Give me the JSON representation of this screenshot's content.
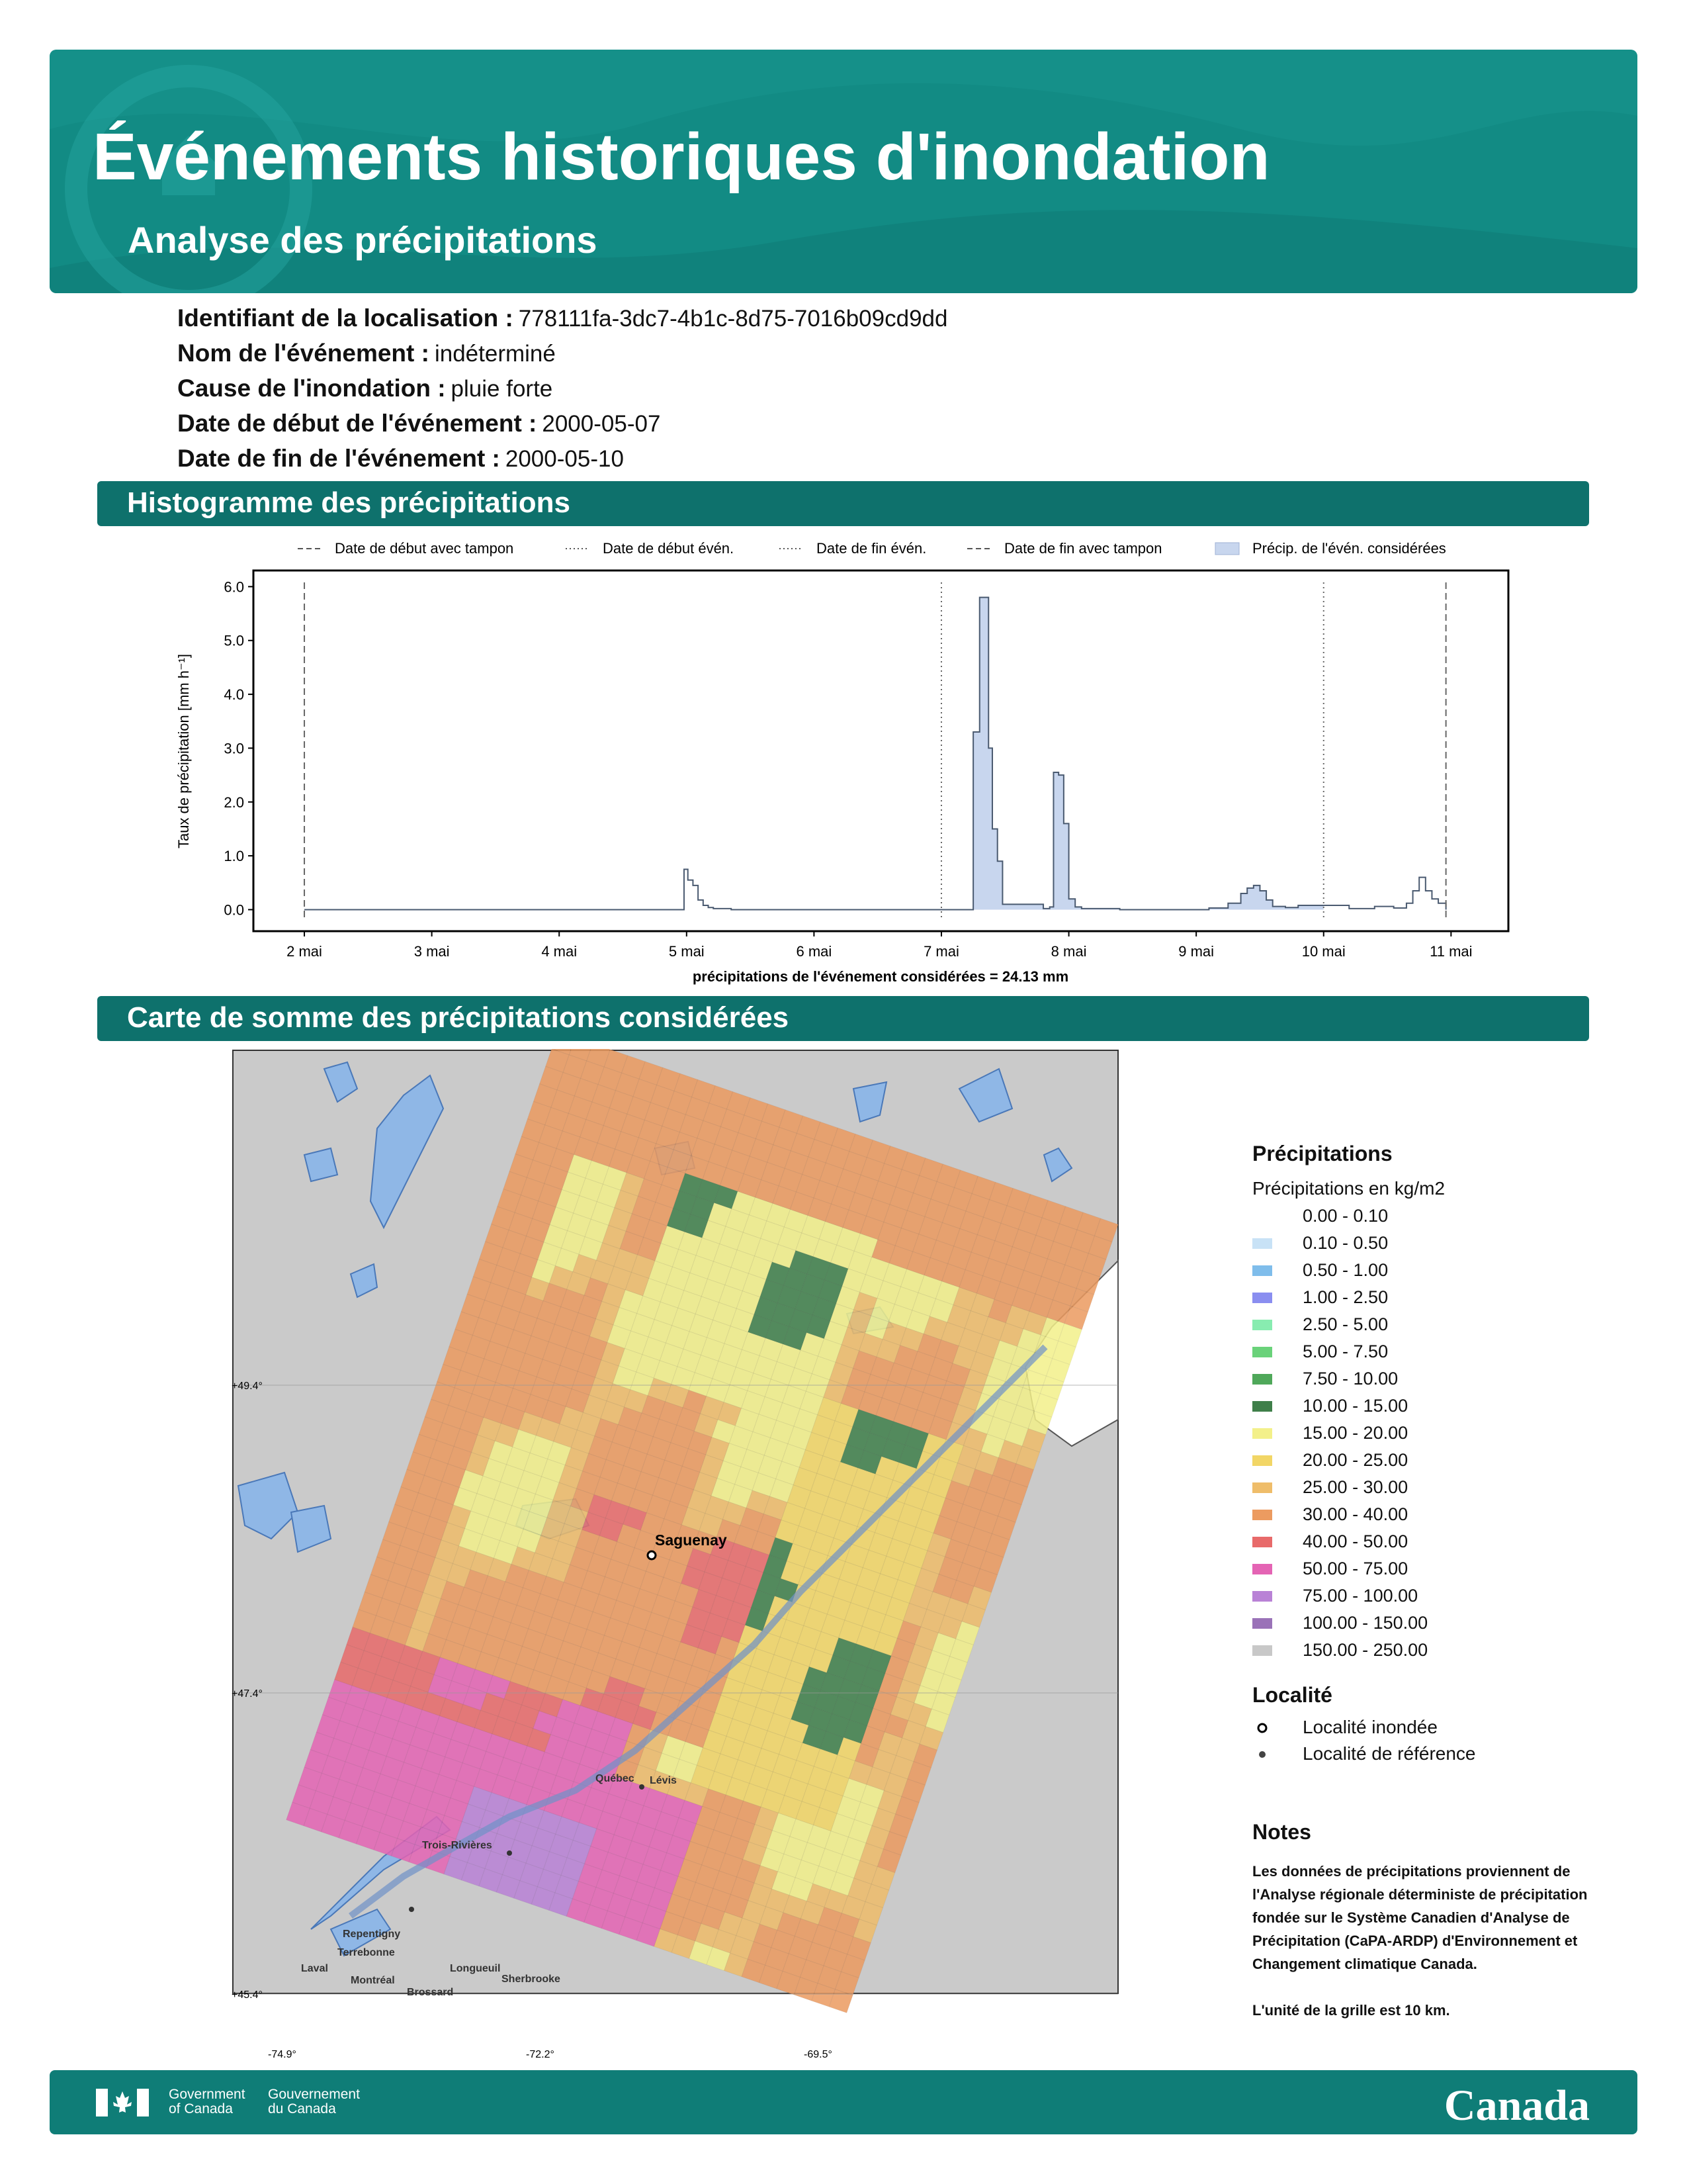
{
  "header": {
    "title": "Événements historiques d'inondation",
    "subtitle": "Analyse des précipitations"
  },
  "event": {
    "fields": [
      {
        "label": "Identifiant de la localisation :",
        "value": "778111fa-3dc7-4b1c-8d75-7016b09cd9dd"
      },
      {
        "label": "Nom de l'événement :",
        "value": "indéterminé"
      },
      {
        "label": "Cause de l'inondation :",
        "value": "pluie forte"
      },
      {
        "label": "Date de début de l'événement :",
        "value": "2000-05-07"
      },
      {
        "label": "Date de fin de l'événement :",
        "value": "2000-05-10"
      }
    ]
  },
  "sections": {
    "histogram": "Histogramme des précipitations",
    "map": "Carte de somme des précipitations considérées"
  },
  "chart_data": {
    "type": "area",
    "ylabel": "Taux de précipitation [mm h⁻¹]",
    "xlabel": "précipitations de l'événement considérées = 24.13 mm",
    "x_range_days": [
      1.6,
      11.45
    ],
    "ylim": [
      -0.4,
      6.3
    ],
    "y_ticks": [
      "0.0",
      "1.0",
      "2.0",
      "3.0",
      "4.0",
      "5.0",
      "6.0"
    ],
    "x_ticks": [
      "2 mai",
      "3 mai",
      "4 mai",
      "5 mai",
      "6 mai",
      "7 mai",
      "8 mai",
      "9 mai",
      "10 mai",
      "11 mai"
    ],
    "legend": [
      {
        "label": "Date de début avec tampon",
        "style": "dashed",
        "color": "#555555"
      },
      {
        "label": "Date de début évén.",
        "style": "dotted",
        "color": "#555555"
      },
      {
        "label": "Date de fin évén.",
        "style": "dotted",
        "color": "#555555"
      },
      {
        "label": "Date de fin avec tampon",
        "style": "dashed",
        "color": "#555555"
      },
      {
        "label": "Précip. de l'évén. considérées",
        "style": "fill",
        "color": "#c8d6ee"
      }
    ],
    "vlines": [
      {
        "x": 2.0,
        "style": "dashed"
      },
      {
        "x": 7.0,
        "style": "dotted"
      },
      {
        "x": 10.0,
        "style": "dotted"
      },
      {
        "x": 10.96,
        "style": "dashed"
      }
    ],
    "event_span": [
      7.0,
      10.0
    ],
    "series": [
      {
        "x": [
          2.0,
          4.95,
          4.98,
          5.01,
          5.05,
          5.09,
          5.13,
          5.17,
          5.21,
          5.25,
          5.35,
          7.0,
          7.2,
          7.25,
          7.3,
          7.33,
          7.37,
          7.4,
          7.44,
          7.48,
          7.8,
          7.85,
          7.88,
          7.92,
          7.96,
          8.0,
          8.05,
          8.1,
          8.4,
          9.1,
          9.25,
          9.35,
          9.4,
          9.45,
          9.5,
          9.55,
          9.6,
          9.7,
          9.8,
          10.0,
          10.2,
          10.4,
          10.55,
          10.65,
          10.7,
          10.75,
          10.8,
          10.85,
          10.9,
          10.96
        ],
        "y": [
          0.0,
          0.0,
          0.75,
          0.55,
          0.45,
          0.18,
          0.08,
          0.04,
          0.02,
          0.02,
          0.0,
          0.0,
          0.0,
          3.3,
          5.8,
          5.8,
          3.0,
          1.5,
          0.9,
          0.1,
          0.02,
          0.05,
          2.55,
          2.5,
          1.6,
          0.2,
          0.05,
          0.02,
          0.0,
          0.03,
          0.12,
          0.3,
          0.4,
          0.45,
          0.35,
          0.18,
          0.06,
          0.04,
          0.08,
          0.08,
          0.02,
          0.06,
          0.03,
          0.12,
          0.35,
          0.6,
          0.35,
          0.2,
          0.12,
          0.0
        ]
      }
    ]
  },
  "map_data": {
    "lat_labels": [
      "+49.4°",
      "+47.4°",
      "+45.4°"
    ],
    "lon_labels": [
      "-74.9°",
      "-72.2°",
      "-69.5°"
    ],
    "cities": [
      {
        "name": "Saguenay",
        "type": "flooded"
      },
      {
        "name": "Québec",
        "type": "reference"
      },
      {
        "name": "Lévis",
        "type": "reference"
      },
      {
        "name": "Trois-Rivières",
        "type": "reference"
      },
      {
        "name": "Repentigny",
        "type": "reference"
      },
      {
        "name": "Terrebonne",
        "type": "reference"
      },
      {
        "name": "Laval",
        "type": "reference"
      },
      {
        "name": "Montréal",
        "type": "reference"
      },
      {
        "name": "Longueuil",
        "type": "reference"
      },
      {
        "name": "Brossard",
        "type": "reference"
      },
      {
        "name": "Sherbrooke",
        "type": "reference"
      }
    ]
  },
  "legend": {
    "title": "Précipitations",
    "unit": "Précipitations en kg/m2",
    "bins": [
      {
        "label": "0.00 - 0.10",
        "color": "#ffffff"
      },
      {
        "label": "0.10 - 0.50",
        "color": "#c8e2f6"
      },
      {
        "label": "0.50 - 1.00",
        "color": "#7fbdeb"
      },
      {
        "label": "1.00 - 2.50",
        "color": "#8a8ef0"
      },
      {
        "label": "2.50 - 5.00",
        "color": "#88ecb0"
      },
      {
        "label": "5.00 - 7.50",
        "color": "#6ad27a"
      },
      {
        "label": "7.50 - 10.00",
        "color": "#4fa85a"
      },
      {
        "label": "10.00 - 15.00",
        "color": "#3f7f4a"
      },
      {
        "label": "15.00 - 20.00",
        "color": "#f3f08a"
      },
      {
        "label": "20.00 - 25.00",
        "color": "#f2d666"
      },
      {
        "label": "25.00 - 30.00",
        "color": "#efbd6a"
      },
      {
        "label": "30.00 - 40.00",
        "color": "#ec9b60"
      },
      {
        "label": "40.00 - 50.00",
        "color": "#e86a6a"
      },
      {
        "label": "50.00 - 75.00",
        "color": "#e464b4"
      },
      {
        "label": "75.00 - 100.00",
        "color": "#b982d6"
      },
      {
        "label": "100.00 - 150.00",
        "color": "#9a72b8"
      },
      {
        "label": "150.00 - 250.00",
        "color": "#c8c8c8"
      }
    ],
    "locality_title": "Localité",
    "localities": [
      {
        "label": "Localité inondée",
        "symbol": "ring"
      },
      {
        "label": "Localité de référence",
        "symbol": "dot"
      }
    ]
  },
  "notes": {
    "title": "Notes",
    "body": "Les données de précipitations proviennent de l'Analyse régionale déterministe de précipitation fondée sur le Système Canadien d'Analyse de Précipitation (CaPA-ARDP) d'Environnement et Changement climatique Canada.",
    "grid": "L'unité de la grille est 10 km."
  },
  "footer": {
    "gov_en_1": "Government",
    "gov_en_2": "of Canada",
    "gov_fr_1": "Gouvernement",
    "gov_fr_2": "du Canada",
    "wordmark": "Canada"
  }
}
